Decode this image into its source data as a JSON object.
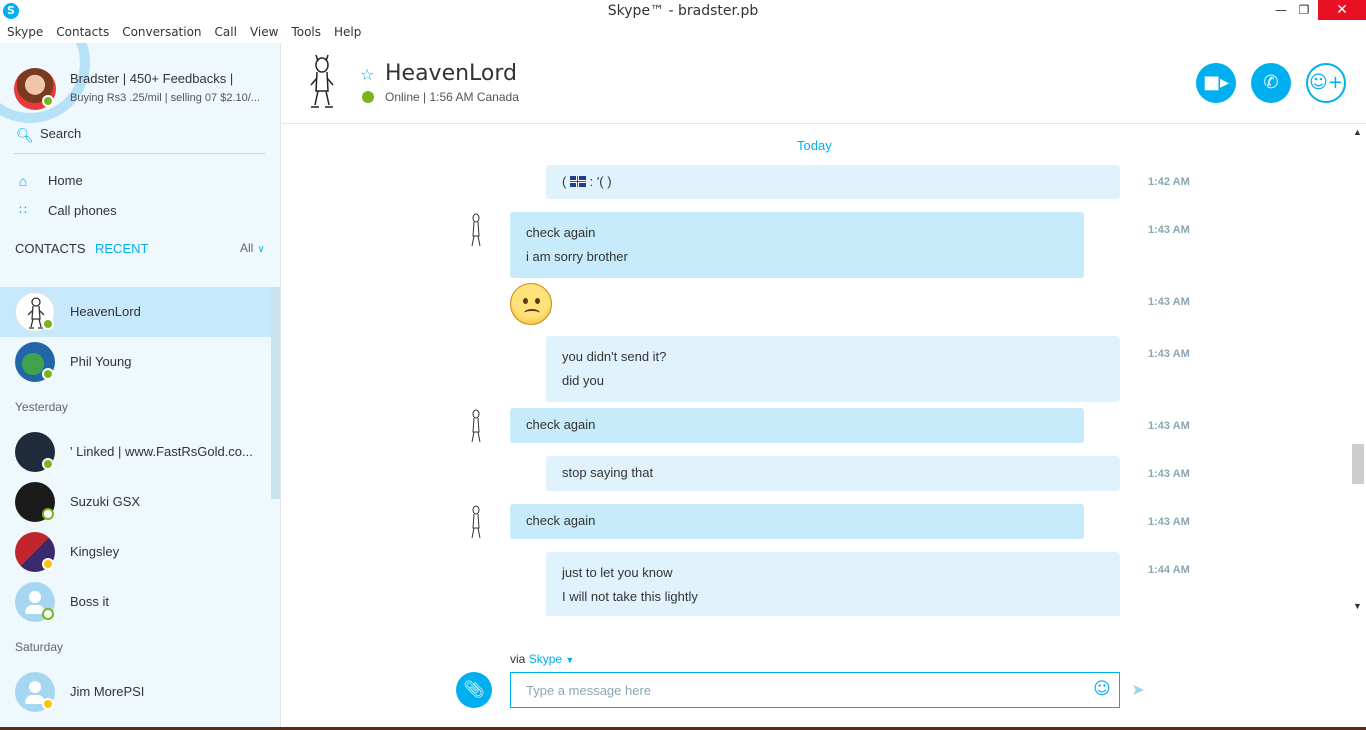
{
  "window": {
    "title": "Skype™ - bradster.pb",
    "app_icon": "S",
    "minimize_glyph": "—",
    "maximize_glyph": "❐",
    "close_glyph": "✕"
  },
  "menubar": [
    "Skype",
    "Contacts",
    "Conversation",
    "Call",
    "View",
    "Tools",
    "Help"
  ],
  "profile": {
    "name": "Bradster | 450+ Feedbacks |",
    "mood": "Buying Rs3 .25/mil | selling 07 $2.10/..."
  },
  "search": {
    "label": "Search",
    "icon": "search-icon"
  },
  "nav": [
    {
      "label": "Home",
      "icon": "home-icon"
    },
    {
      "label": "Call phones",
      "icon": "dialpad-icon"
    }
  ],
  "tabs": {
    "contacts": "CONTACTS",
    "recent": "RECENT",
    "filter": "All"
  },
  "groups": {
    "yesterday": "Yesterday",
    "saturday": "Saturday"
  },
  "contacts": [
    {
      "name": "HeavenLord",
      "status": "online",
      "selected": true
    },
    {
      "name": "Phil Young",
      "status": "online"
    },
    {
      "name": "'    Linked | www.FastRsGold.co...",
      "status": "online"
    },
    {
      "name": "Suzuki GSX",
      "status": "offline"
    },
    {
      "name": "Kingsley",
      "status": "away"
    },
    {
      "name": "Boss it",
      "status": "offline"
    },
    {
      "name": "Jim MorePSI",
      "status": "away"
    }
  ],
  "chat": {
    "name": "HeavenLord",
    "status": "Online  |  1:56 AM Canada",
    "status_color": "#7ab51d",
    "accent": "#00aff0"
  },
  "conversation": {
    "day": "Today",
    "messages": [
      {
        "from": "me",
        "lines": [
          ": '( )"
        ],
        "prefix": "(",
        "time": "1:42 AM"
      },
      {
        "from": "them",
        "lines": [
          "check again",
          "i am sorry brother"
        ],
        "time": "1:43 AM"
      },
      {
        "from": "them",
        "emoji": "worried-face",
        "time": "1:43 AM"
      },
      {
        "from": "me",
        "lines": [
          "you didn't send it?",
          "did you"
        ],
        "time": "1:43 AM"
      },
      {
        "from": "them",
        "lines": [
          "check again"
        ],
        "time": "1:43 AM"
      },
      {
        "from": "me",
        "lines": [
          "stop saying that"
        ],
        "time": "1:43 AM"
      },
      {
        "from": "them",
        "lines": [
          "check again"
        ],
        "time": "1:43 AM"
      },
      {
        "from": "me",
        "lines": [
          "just to let you know",
          "I will not take this lightly"
        ],
        "time": "1:44 AM"
      }
    ]
  },
  "composer": {
    "via_label": "via",
    "service": "Skype",
    "placeholder": "Type a message here"
  }
}
